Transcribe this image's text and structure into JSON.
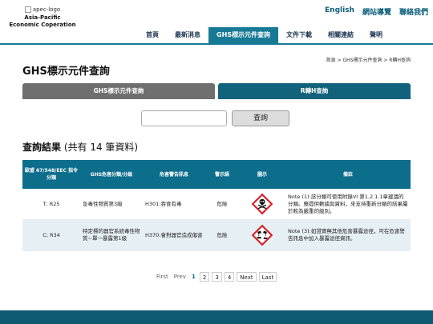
{
  "header": {
    "logo_alt": "apec-logo",
    "org_name_line1": "Asia-Pacific",
    "org_name_line2": "Economic Coperation",
    "utility_links": [
      "English",
      "網站導覽",
      "聯絡我們"
    ]
  },
  "nav": {
    "items": [
      "首頁",
      "最新消息",
      "GHS標示元件查詢",
      "文件下載",
      "相關連結",
      "聲明"
    ],
    "active_index": 2
  },
  "breadcrumb": "首頁 > GHS標示元件查詢 > R轉H查詢",
  "page_title": "GHS標示元件查詢",
  "tabs": [
    "GHS標示元件查詢",
    "R轉H查詢"
  ],
  "search": {
    "value": "",
    "button_label": "查詢"
  },
  "results": {
    "heading_strong": "查詢結果",
    "heading_count": " (共有 14 筆資料)",
    "columns": [
      "歐盟 67/548/EEC 指令分類",
      "GHS危害分類/分級",
      "危害警告訊息",
      "警示語",
      "圖示",
      "備註"
    ],
    "rows": [
      {
        "eu_class": "T; R25",
        "ghs_class": "急毒性物質第3級",
        "hazard_statement": "H301:吞食有毒",
        "signal_word": "危險",
        "pictogram": "skull-and-crossbones-icon",
        "note": "Note (1):該分類可使用附錄VI 第1.2.1.1章建議的分類。應提供數據與資料，來支持重新分類的結果屬於較為嚴重的級別。"
      },
      {
        "eu_class": "C; R34",
        "ghs_class": "特定標的器官系統毒性物質~單一暴露第1級",
        "hazard_statement": "H370:會對器官造成傷害",
        "signal_word": "危險",
        "pictogram": "corrosion-icon",
        "note": "Note (3):如證實無其他危害暴露途徑，可在危害警告訊息中加入暴露途徑資訊。"
      }
    ]
  },
  "pagination": {
    "first": "First",
    "prev": "Prev",
    "pages": [
      "1",
      "2",
      "3",
      "4"
    ],
    "current": "1",
    "next": "Next",
    "last": "Last"
  },
  "colors": {
    "primary": "#167a96",
    "table_header": "#0d6e8c",
    "tab_inactive": "#6f6f6f",
    "tab_active": "#12627c",
    "footer": "#0f5a73",
    "pictogram_border": "#d81f26"
  }
}
